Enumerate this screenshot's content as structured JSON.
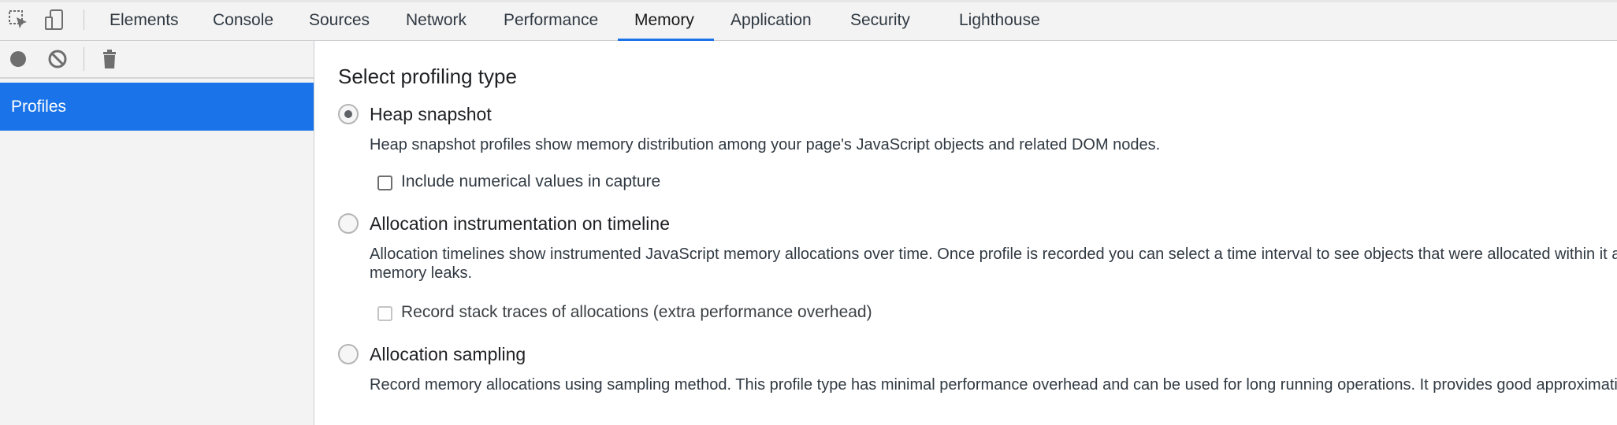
{
  "tabs": [
    {
      "label": "Elements"
    },
    {
      "label": "Console"
    },
    {
      "label": "Sources"
    },
    {
      "label": "Network"
    },
    {
      "label": "Performance"
    },
    {
      "label": "Memory",
      "active": true
    },
    {
      "label": "Application"
    },
    {
      "label": "Security"
    },
    {
      "label": "Lighthouse"
    }
  ],
  "toolbar_icons": [
    "inspect-element-icon",
    "device-toolbar-icon"
  ],
  "sidebar": {
    "icons": [
      "record-icon",
      "clear-icon",
      "trash-icon"
    ],
    "items": [
      {
        "label": "Profiles",
        "selected": true
      }
    ]
  },
  "main": {
    "heading": "Select profiling type",
    "options": [
      {
        "label": "Heap snapshot",
        "selected": true,
        "description": "Heap snapshot profiles show memory distribution among your page's JavaScript objects and related DOM nodes.",
        "checkbox": {
          "label": "Include numerical values in capture",
          "checked": false
        }
      },
      {
        "label": "Allocation instrumentation on timeline",
        "selected": false,
        "description_line1": "Allocation timelines show instrumented JavaScript memory allocations over time. Once profile is recorded you can select a time interval to see objects that were allocated within it and still alive by the end of recording. Use this profile type to isolate",
        "description_line2": "memory leaks.",
        "checkbox": {
          "label": "Record stack traces of allocations (extra performance overhead)",
          "checked": false,
          "disabled": true
        }
      },
      {
        "label": "Allocation sampling",
        "selected": false,
        "description": "Record memory allocations using sampling method. This profile type has minimal performance overhead and can be used for long running operations. It provides good approximation of allocations broken down by JavaScript execution stack."
      }
    ]
  },
  "colors": {
    "accent": "#1a73e8",
    "panel_bg": "#f3f3f3",
    "border": "#cbcdd1"
  }
}
